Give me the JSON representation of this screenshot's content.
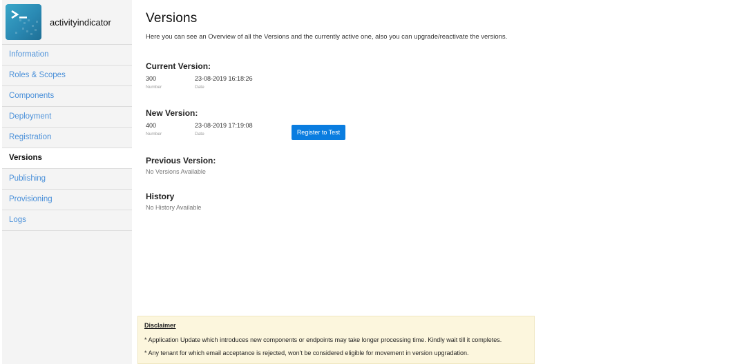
{
  "app": {
    "name": "activityindicator",
    "logo_icon": "terminal-icon"
  },
  "sidebar": {
    "items": [
      {
        "label": "Information",
        "active": false
      },
      {
        "label": "Roles & Scopes",
        "active": false
      },
      {
        "label": "Components",
        "active": false
      },
      {
        "label": "Deployment",
        "active": false
      },
      {
        "label": "Registration",
        "active": false
      },
      {
        "label": "Versions",
        "active": true
      },
      {
        "label": "Publishing",
        "active": false
      },
      {
        "label": "Provisioning",
        "active": false
      },
      {
        "label": "Logs",
        "active": false
      }
    ]
  },
  "page": {
    "title": "Versions",
    "description": "Here you can see an Overview of all the Versions and the currently active one, also you can upgrade/reactivate the versions."
  },
  "current_version": {
    "title": "Current Version:",
    "number": "300",
    "number_label": "Number",
    "date": "23-08-2019 16:18:26",
    "date_label": "Date"
  },
  "new_version": {
    "title": "New Version:",
    "number": "400",
    "number_label": "Number",
    "date": "23-08-2019 17:19:08",
    "date_label": "Date",
    "button_label": "Register to Test"
  },
  "previous_version": {
    "title": "Previous Version:",
    "empty_text": "No Versions Available"
  },
  "history": {
    "title": "History",
    "empty_text": "No History Available"
  },
  "disclaimer": {
    "title": "Disclaimer",
    "lines": [
      "* Application Update which introduces new components or endpoints may take longer processing time. Kindly wait till it completes.",
      "* Any tenant for which email acceptance is rejected, won't be considered eligible for movement in version upgradation."
    ]
  },
  "colors": {
    "accent": "#0a7de0",
    "nav_link": "#4a90d9",
    "sidebar_bg": "#f4f4f4",
    "disclaimer_bg": "#fcf6dd"
  }
}
